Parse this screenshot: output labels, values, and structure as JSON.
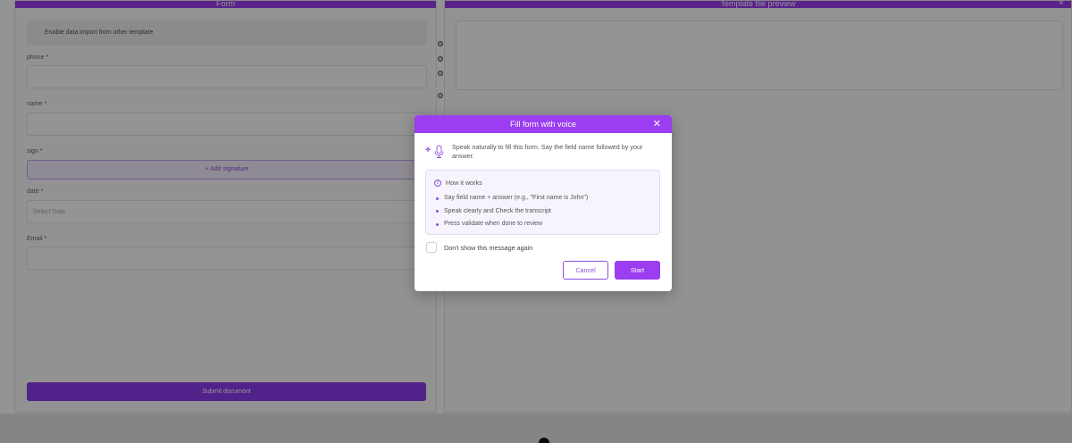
{
  "background": {
    "left_panel_title": "Form",
    "right_panel_title": "Template file preview",
    "shared_option": "Enable data import from other template",
    "fields": [
      {
        "label": "phone *"
      },
      {
        "label": "name *"
      },
      {
        "label": "sign *"
      },
      {
        "label": "date *"
      },
      {
        "label": "Email *"
      }
    ],
    "add_signature_label": "+ Add signature",
    "date_placeholder": "Select Date",
    "submit_label": "Submit document"
  },
  "modal": {
    "title": "Fill form with voice",
    "intro": "Speak naturally to fill this form. Say the field name followed by your answer.",
    "info_title": "How it works",
    "info_items": [
      "Say field name + answer (e.g., \"First name is John\")",
      "Speak clearly and Check the transcript",
      "Press validate when done to review"
    ],
    "checkbox_label": "Don't show this message again",
    "cancel_label": "Cancel",
    "start_label": "Start"
  },
  "colors": {
    "accent": "#9b3df0",
    "info_bg": "#f7f4fd"
  },
  "icons": [
    "close-icon",
    "sparkle-icon",
    "microphone-icon",
    "info-icon"
  ]
}
